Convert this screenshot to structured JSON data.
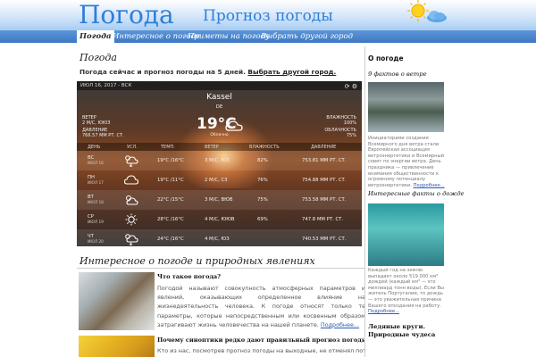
{
  "header": {
    "site_title": "Погода",
    "site_subtitle": "Прогноз погоды",
    "sun_icon": "sun-icon",
    "cloud_icon": "cloud-icon"
  },
  "nav": {
    "items": [
      {
        "label": "Погода",
        "active": true
      },
      {
        "label": "Интересное о погоде",
        "active": false
      },
      {
        "label": "Приметы на погоду",
        "active": false
      },
      {
        "label": "Выбрать другой город",
        "active": false
      }
    ]
  },
  "main": {
    "title": "Погода",
    "intro_text": "Погода сейчас и прогноз погоды на 5 дней.",
    "intro_link": "Выбрать другой город."
  },
  "widget": {
    "date_bar": "ИЮЛ 16, 2017 - ВСК",
    "city": "Kassel",
    "country": "DE",
    "temperature": "19°C",
    "condition": "Облачно",
    "wind_label": "ВЕТЕР",
    "wind_value": "2 М/С, ЮЮЗ",
    "pressure_label": "ДАВЛЕНИЕ",
    "pressure_value": "766.57 ММ РТ. СТ.",
    "humidity_label": "ВЛАЖНОСТЬ",
    "humidity_value": "100%",
    "cloud_label": "ОБЛАЧНОСТЬ",
    "cloud_value": "75%",
    "columns": [
      "ДЕНЬ",
      "УСЛ.",
      "ТЕМП.",
      "ВЕТЕР",
      "ВЛАЖНОСТЬ",
      "ДАВЛЕНИЕ"
    ],
    "rows": [
      {
        "day": "ВС",
        "date": "ИЮЛ 16",
        "icon": "storm-cloud-icon",
        "temp": "19°C /16°C",
        "wind": "3 М/С, ЮЗ",
        "humidity": "82%",
        "pressure": "753.81 ММ РТ. СТ."
      },
      {
        "day": "ПН",
        "date": "ИЮЛ 17",
        "icon": "cloud-icon",
        "temp": "19°C /11°C",
        "wind": "2 М/С, СЗ",
        "humidity": "76%",
        "pressure": "754.88 ММ РТ. СТ."
      },
      {
        "day": "ВТ",
        "date": "ИЮЛ 18",
        "icon": "partly-cloudy-icon",
        "temp": "22°C /15°C",
        "wind": "3 М/С, ВЮВ",
        "humidity": "75%",
        "pressure": "753.58 ММ РТ. СТ."
      },
      {
        "day": "СР",
        "date": "ИЮЛ 19",
        "icon": "sun-icon",
        "temp": "28°C /16°C",
        "wind": "4 М/С, ЮЮВ",
        "humidity": "69%",
        "pressure": "747.8 ММ РТ. СТ."
      },
      {
        "day": "ЧТ",
        "date": "ИЮЛ 20",
        "icon": "storm-cloud-icon",
        "temp": "24°C /16°C",
        "wind": "4 М/С, ЮЗ",
        "humidity": "",
        "pressure": "740.53 ММ РТ. СТ."
      }
    ]
  },
  "section": {
    "title": "Интересное о погоде и природных явлениях",
    "articles": [
      {
        "title": "Что такое погода?",
        "text": "Погодой называют совокупность атмосферных параметров и явлений, оказывающих определенное влияние на жизнедеятельность человека. К погоде относят только те параметры, которые непосредственным или косвенным образом затрагивают жизнь человечества на нашей планете.",
        "more": "Подробнее..."
      },
      {
        "title": "Почему синоптики редко дают правильный прогноз погоды?",
        "text": "Кто из нас, посмотрев прогноз погоды на выходные, не отменял потом",
        "more": ""
      }
    ]
  },
  "sidebar": {
    "heading": "О погоде",
    "block1_title": "9 фактов о ветре",
    "block1_text": "Инициаторами создания Всемирного дня ветра стали Европейская ассоциация ветроэнергетики и Всемирный совет по энергии ветра. День праздника — привлечение внимания общественности к огромному потенциалу ветроэнергетики.",
    "block1_more": "Подробнее...",
    "block2_title": "Интересные факты о дожде",
    "block2_text": "Каждый год на землю выпадает около 519 000 км³ дождей (каждый км³ — это миллиард тонн воды). Если Вы житель Португалии, то дождь — это уважительная причина Вашего опоздания на работу.",
    "block2_more": "Подробнее...",
    "block3_title": "Ледяные круги. Природные чудеса"
  }
}
